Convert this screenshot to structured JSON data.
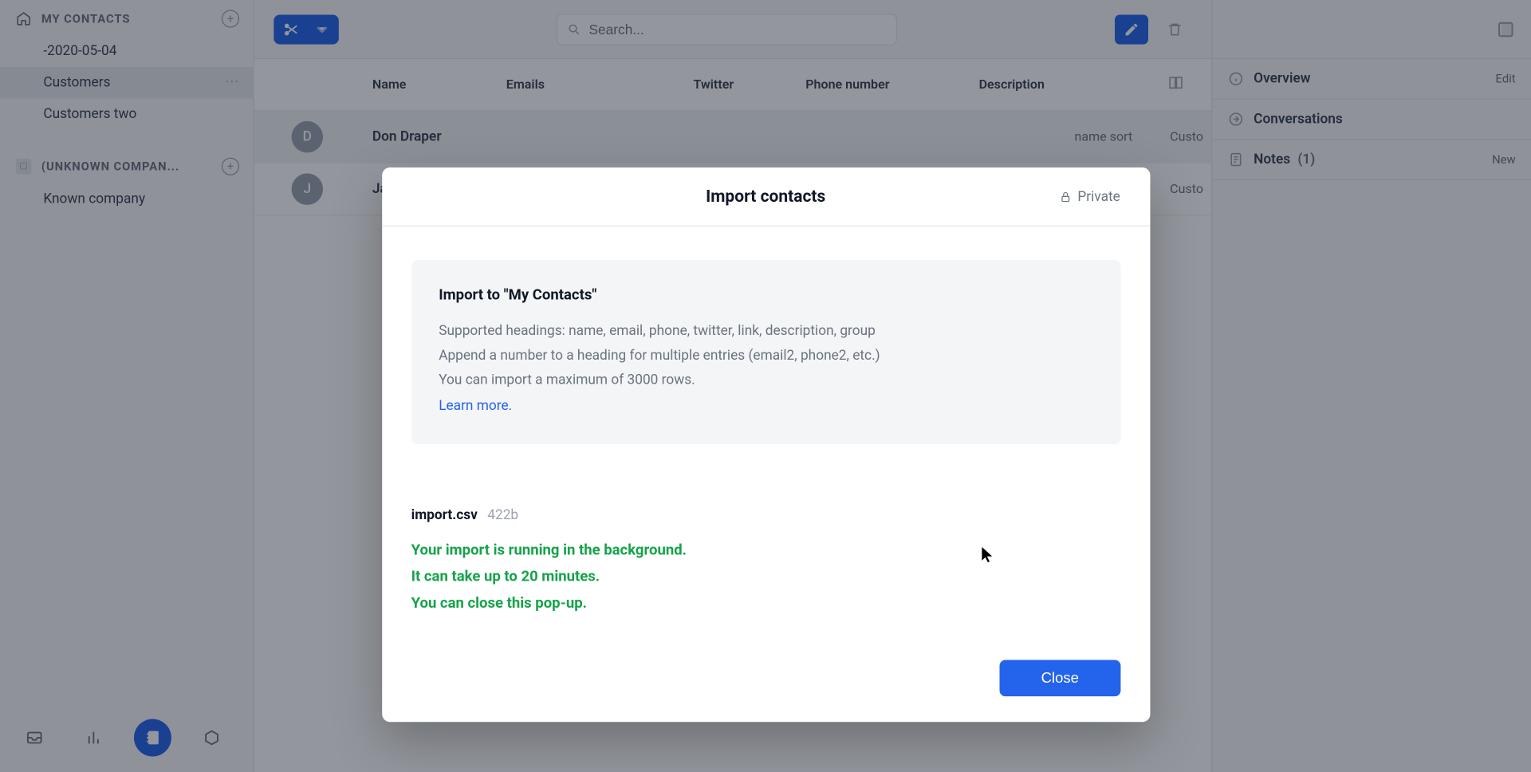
{
  "sidebar": {
    "section1_title": "MY CONTACTS",
    "items": [
      {
        "label": "-2020-05-04"
      },
      {
        "label": "Customers"
      },
      {
        "label": "Customers two"
      }
    ],
    "section2_title": "(UNKNOWN COMPAN...",
    "section2_items": [
      {
        "label": "Known company"
      }
    ]
  },
  "search": {
    "placeholder": "Search..."
  },
  "table": {
    "headers": {
      "name": "Name",
      "emails": "Emails",
      "twitter": "Twitter",
      "phone": "Phone number",
      "description": "Description"
    },
    "rows": [
      {
        "initial": "D",
        "name": "Don Draper",
        "name_sort": "name sort",
        "segments": "Custo"
      },
      {
        "initial": "J",
        "name": "James Jonas",
        "segments": "Custo"
      }
    ]
  },
  "right_panel": {
    "overview_label": "Overview",
    "overview_action": "Edit",
    "conversations_label": "Conversations",
    "notes_label": "Notes",
    "notes_count": "(1)",
    "notes_action": "New"
  },
  "modal": {
    "title": "Import contacts",
    "private_label": "Private",
    "info_title": "Import to \"My Contacts\"",
    "info_line1": "Supported headings: name, email, phone, twitter, link, description, group",
    "info_line2": "Append a number to a heading for multiple entries (email2, phone2, etc.)",
    "info_line3": "You can import a maximum of 3000 rows.",
    "learn_more": "Learn more.",
    "file_name": "import.csv",
    "file_size": "422b",
    "status_line1": "Your import is running in the background.",
    "status_line2": "It can take up to 20 minutes.",
    "status_line3": "You can close this pop-up.",
    "close_btn": "Close"
  }
}
